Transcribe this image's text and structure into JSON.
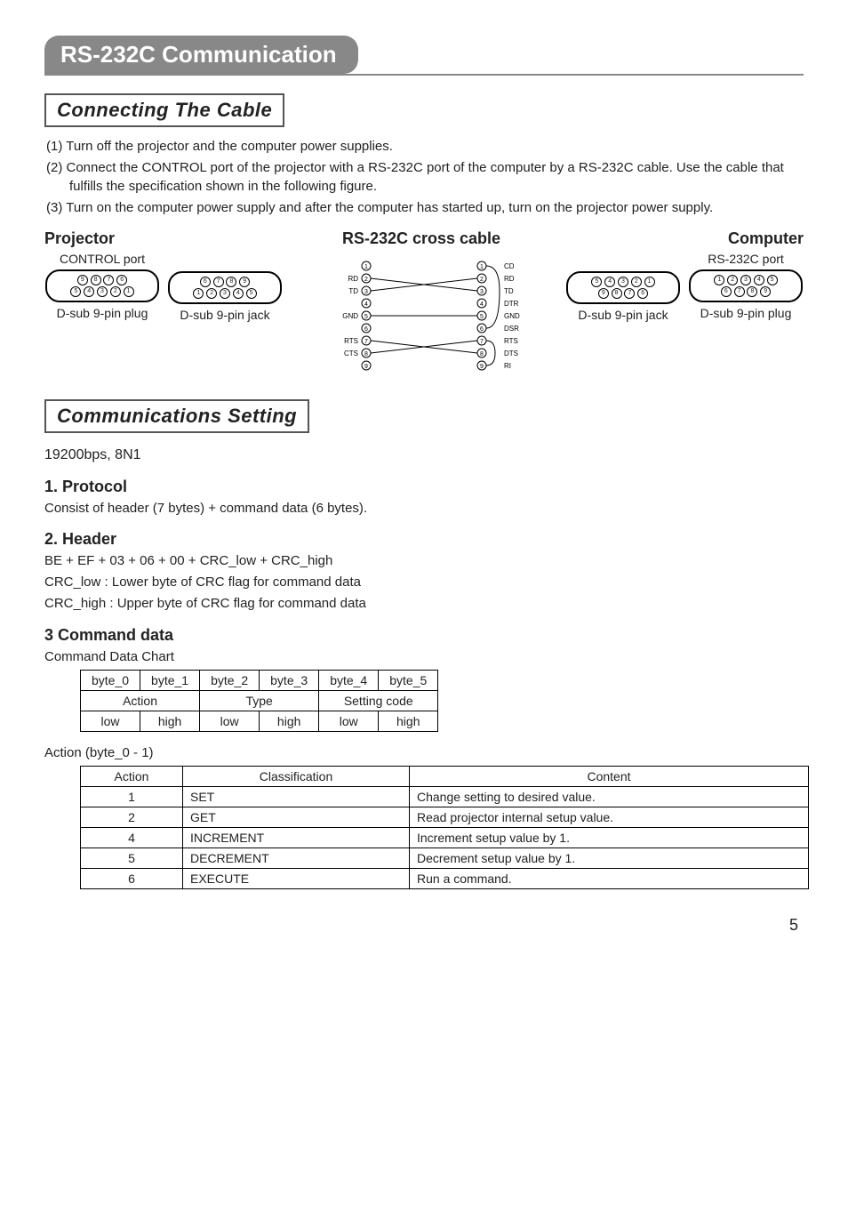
{
  "title": "RS-232C Communication",
  "section1": {
    "heading": "Connecting The Cable",
    "steps": [
      "(1) Turn off the projector and the computer power supplies.",
      "(2) Connect the CONTROL port of the projector with a RS-232C port of the computer by a RS-232C cable. Use the cable that fulfills the specification shown in the following figure.",
      "(3) Turn on the computer power supply and after the computer has started up, turn on the projector power supply."
    ],
    "labels": {
      "left": "Projector",
      "mid": "RS-232C cross cable",
      "right": "Computer"
    },
    "ports": {
      "projector_label": "CONTROL port",
      "computer_label": "RS-232C port",
      "plug": "D-sub 9-pin plug",
      "jack": "D-sub 9-pin jack"
    },
    "wiring": {
      "left_pins": [
        "—",
        "RD",
        "TD",
        "—",
        "GND",
        "—",
        "RTS",
        "CTS",
        "—"
      ],
      "right_pins": [
        "CD",
        "RD",
        "TD",
        "DTR",
        "GND",
        "DSR",
        "RTS",
        "DTS",
        "RI"
      ],
      "connections": [
        {
          "from": 2,
          "to": 3
        },
        {
          "from": 3,
          "to": 2
        },
        {
          "from": 5,
          "to": 5
        },
        {
          "from": 7,
          "to": 8
        },
        {
          "from": 8,
          "to": 7
        }
      ],
      "right_shorts": [
        [
          1,
          4,
          6
        ],
        [
          7,
          8
        ]
      ]
    }
  },
  "section2": {
    "heading": "Communications Setting",
    "baud": "19200bps,  8N1",
    "protocol_h": "1. Protocol",
    "protocol_t": "Consist of header (7 bytes) + command data (6 bytes).",
    "header_h": "2. Header",
    "header_lines": [
      "BE + EF + 03 + 06 + 00 + CRC_low + CRC_high",
      "CRC_low : Lower byte of CRC flag for command data",
      "CRC_high : Upper byte of CRC flag for command data"
    ],
    "cmd_h": "3 Command data",
    "cmd_sub": "Command Data Chart",
    "byte_table": {
      "headers": [
        "byte_0",
        "byte_1",
        "byte_2",
        "byte_3",
        "byte_4",
        "byte_5"
      ],
      "groups": [
        "Action",
        "Type",
        "Setting code"
      ],
      "cells": [
        "low",
        "high",
        "low",
        "high",
        "low",
        "high"
      ]
    },
    "action_sub": "Action (byte_0 - 1)",
    "action_table": {
      "headers": [
        "Action",
        "Classification",
        "Content"
      ],
      "rows": [
        [
          "1",
          "SET",
          "Change setting to desired value."
        ],
        [
          "2",
          "GET",
          "Read projector internal setup value."
        ],
        [
          "4",
          "INCREMENT",
          "Increment setup value by 1."
        ],
        [
          "5",
          "DECREMENT",
          "Decrement setup value by 1."
        ],
        [
          "6",
          "EXECUTE",
          "Run a command."
        ]
      ]
    }
  },
  "page": "5"
}
